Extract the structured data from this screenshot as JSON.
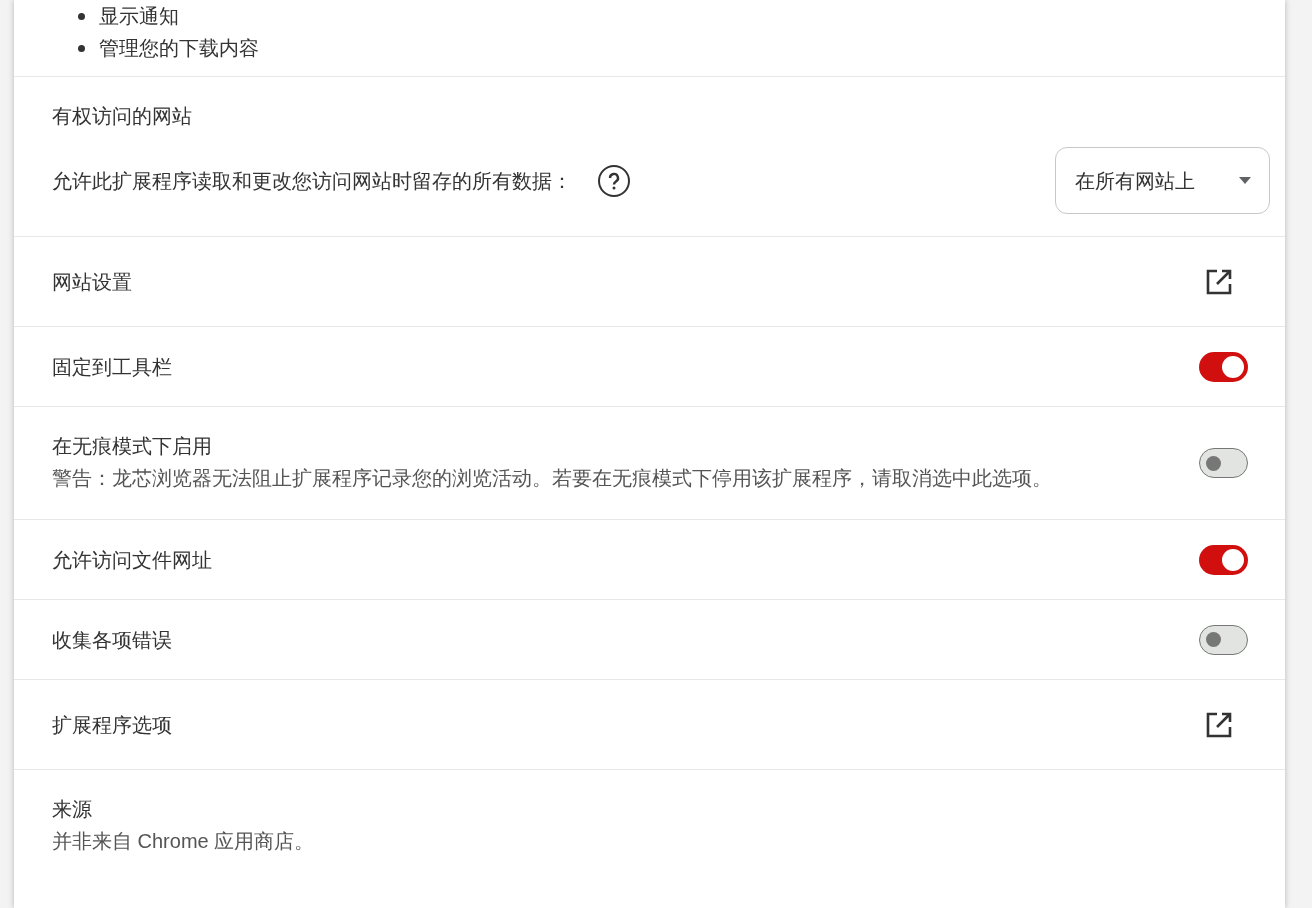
{
  "permissions": [
    "显示通知",
    "管理您的下载内容"
  ],
  "site_access": {
    "title": "有权访问的网站",
    "label": "允许此扩展程序读取和更改您访问网站时留存的所有数据：",
    "dropdown": "在所有网站上"
  },
  "rows": [
    {
      "kind": "link",
      "title": "网站设置"
    },
    {
      "kind": "toggle",
      "title": "固定到工具栏",
      "on": true
    },
    {
      "kind": "toggle",
      "title": "在无痕模式下启用",
      "description": "警告：龙芯浏览器无法阻止扩展程序记录您的浏览活动。若要在无痕模式下停用该扩展程序，请取消选中此选项。",
      "on": false
    },
    {
      "kind": "toggle",
      "title": "允许访问文件网址",
      "on": true
    },
    {
      "kind": "toggle",
      "title": "收集各项错误",
      "on": false
    },
    {
      "kind": "link",
      "title": "扩展程序选项"
    },
    {
      "kind": "info",
      "title": "来源",
      "description": "并非来自 Chrome 应用商店。"
    }
  ]
}
